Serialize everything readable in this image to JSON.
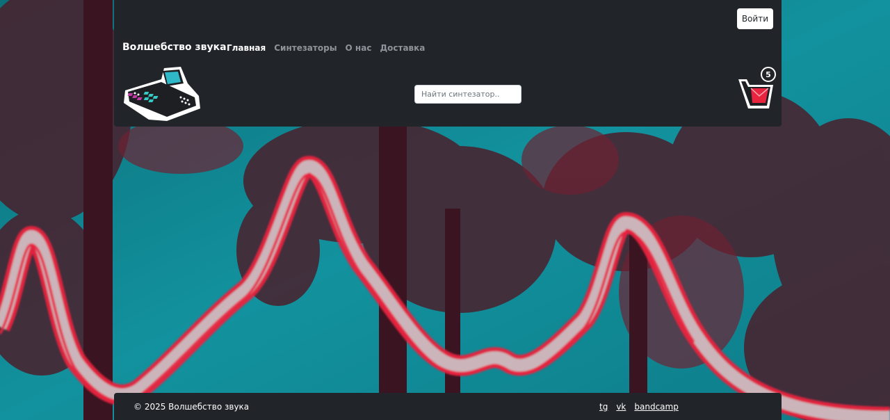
{
  "header": {
    "brand": "Волшебство звука",
    "login_label": "Войти",
    "nav": [
      {
        "label": "Главная",
        "active": true
      },
      {
        "label": "Синтезаторы",
        "active": false
      },
      {
        "label": "О нас",
        "active": false
      },
      {
        "label": "Доставка",
        "active": false
      }
    ],
    "search": {
      "placeholder": "Найти синтезатор.."
    },
    "cart": {
      "count": "5",
      "icon": "cart-icon"
    },
    "logo_icon": "synthesizer-icon"
  },
  "footer": {
    "copyright": "© 2025 Волшебство звука",
    "links": [
      "tg",
      "vk",
      "bandcamp"
    ]
  },
  "colors": {
    "panel": "#212529",
    "accent_red": "#e8243f",
    "teal": "#12919c"
  }
}
